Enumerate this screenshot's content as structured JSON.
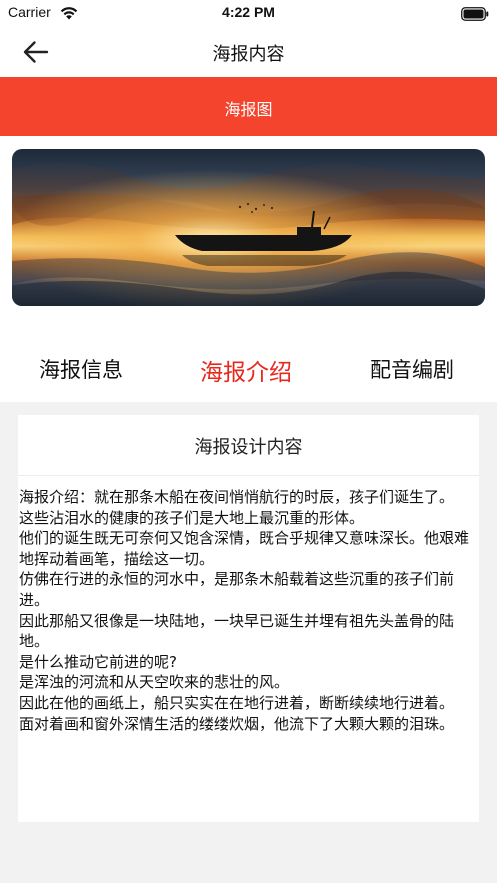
{
  "status_bar": {
    "carrier": "Carrier",
    "time": "4:22 PM"
  },
  "nav": {
    "title": "海报内容",
    "back_icon": "arrow-left-icon"
  },
  "banner": {
    "label": "海报图",
    "color": "#f4442e"
  },
  "tabs": [
    {
      "label": "海报信息",
      "active": false
    },
    {
      "label": "海报介绍",
      "active": true
    },
    {
      "label": "配音编剧",
      "active": false
    }
  ],
  "card": {
    "title": "海报设计内容",
    "paragraphs": [
      "海报介绍：就在那条木船在夜间悄悄航行的时辰，孩子们诞生了。",
      "这些沾泪水的健康的孩子们是大地上最沉重的形体。",
      "他们的诞生既无可奈何又饱含深情，既合乎规律又意味深长。他艰难地挥动着画笔，描绘这一切。",
      "仿佛在行进的永恒的河水中，是那条木船载着这些沉重的孩子们前进。",
      "因此那船又很像是一块陆地，一块早已诞生并埋有祖先头盖骨的陆地。",
      "是什么推动它前进的呢?",
      "是浑浊的河流和从天空吹来的悲壮的风。",
      "因此在他的画纸上，船只实实在在地行进着，断断续续地行进着。",
      "面对着画和窗外深情生活的缕缕炊烟，他流下了大颗大颗的泪珠。"
    ]
  },
  "colors": {
    "active_tab": "#e8281d",
    "background": "#f2f2f2"
  }
}
